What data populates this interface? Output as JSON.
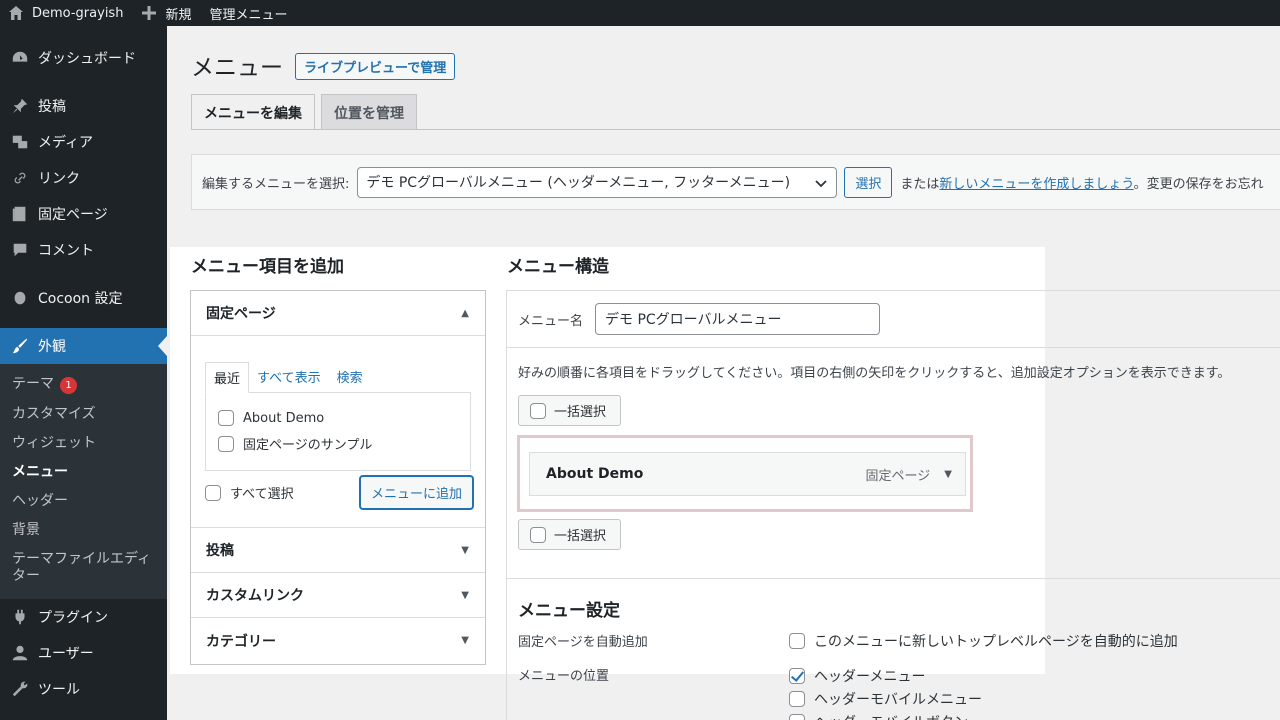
{
  "adminbar": {
    "site_name": "Demo-grayish",
    "new_label": "新規",
    "admin_menu_label": "管理メニュー"
  },
  "sidebar": {
    "items": [
      {
        "label": "ダッシュボード",
        "icon": "dashboard-icon"
      },
      {
        "label": "投稿",
        "icon": "pin-icon"
      },
      {
        "label": "メディア",
        "icon": "media-icon"
      },
      {
        "label": "リンク",
        "icon": "link-icon"
      },
      {
        "label": "固定ページ",
        "icon": "page-icon"
      },
      {
        "label": "コメント",
        "icon": "comment-icon"
      },
      {
        "label": "Cocoon 設定",
        "icon": "cocoon-icon"
      },
      {
        "label": "外観",
        "icon": "brush-icon"
      },
      {
        "label": "プラグイン",
        "icon": "plugin-icon"
      },
      {
        "label": "ユーザー",
        "icon": "user-icon"
      },
      {
        "label": "ツール",
        "icon": "wrench-icon"
      }
    ],
    "submenu": {
      "theme": "テーマ",
      "theme_badge": "1",
      "customize": "カスタマイズ",
      "widget": "ウィジェット",
      "menu": "メニュー",
      "header": "ヘッダー",
      "background": "背景",
      "theme_editor": "テーマファイルエディター"
    }
  },
  "main": {
    "title": "メニュー",
    "live_preview_label": "ライブプレビューで管理",
    "tabs": [
      {
        "label": "メニューを編集"
      },
      {
        "label": "位置を管理"
      }
    ],
    "select_bar": {
      "label": "編集するメニューを選択:",
      "selected": "デモ PCグローバルメニュー (ヘッダーメニュー, フッターメニュー)",
      "select_button": "選択",
      "after_text_prefix": "または",
      "create_link": "新しいメニューを作成しましょう",
      "after_text_suffix": "。変更の保存をお忘れ"
    }
  },
  "add_items": {
    "heading": "メニュー項目を追加",
    "open_section": "固定ページ",
    "inner_tabs": [
      "最近",
      "すべて表示",
      "検索"
    ],
    "pages": [
      "About Demo",
      "固定ページのサンプル"
    ],
    "select_all": "すべて選択",
    "add_button": "メニューに追加",
    "closed_sections": [
      "投稿",
      "カスタムリンク",
      "カテゴリー"
    ]
  },
  "structure": {
    "heading": "メニュー構造",
    "name_label": "メニュー名",
    "name_value": "デモ PCグローバルメニュー",
    "instructions": "好みの順番に各項目をドラッグしてください。項目の右側の矢印をクリックすると、追加設定オプションを表示できます。",
    "bulk_select": "一括選択",
    "item_title": "About Demo",
    "item_type": "固定ページ",
    "settings_heading": "メニュー設定",
    "auto_add_label": "固定ページを自動追加",
    "auto_add_option": "このメニューに新しいトップレベルページを自動的に追加",
    "location_label": "メニューの位置",
    "locations": [
      {
        "label": "ヘッダーメニュー",
        "checked": true
      },
      {
        "label": "ヘッダーモバイルメニュー",
        "checked": false
      },
      {
        "label": "ヘッダーモバイルボタン",
        "checked": false
      }
    ]
  },
  "colors": {
    "admin_dark": "#1d2327",
    "accent": "#2271b1",
    "highlight_border": "#dfc9cd"
  }
}
